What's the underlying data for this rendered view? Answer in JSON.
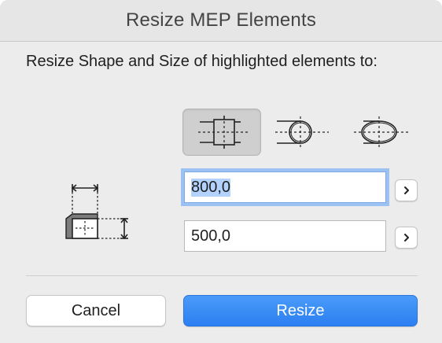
{
  "dialog": {
    "title": "Resize MEP Elements",
    "prompt": "Resize Shape and Size of  highlighted elements to:"
  },
  "shape_options": [
    {
      "icon": "rectangular-duct-icon",
      "selected": true
    },
    {
      "icon": "circular-duct-icon",
      "selected": false
    },
    {
      "icon": "oval-duct-icon",
      "selected": false
    }
  ],
  "fields": {
    "width_value": "800,0",
    "height_value": "500,0"
  },
  "buttons": {
    "cancel_label": "Cancel",
    "resize_label": "Resize"
  },
  "colors": {
    "accent": "#2f83f2",
    "focus_ring": "#9cc2f4",
    "selected_segment": "#cfcfcf"
  }
}
